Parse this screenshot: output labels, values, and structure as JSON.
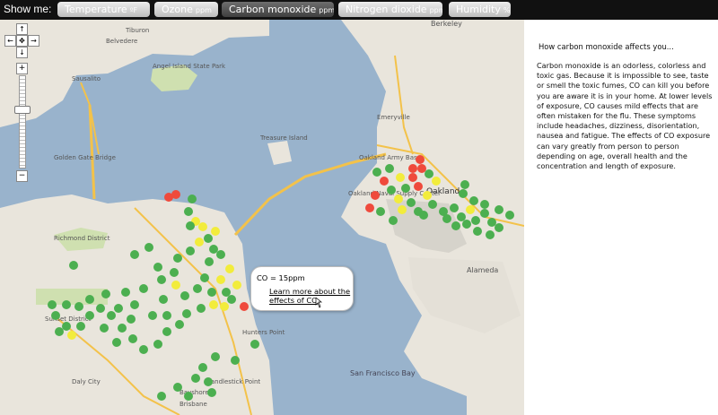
{
  "header": {
    "show_me_label": "Show me:",
    "tabs": [
      {
        "label": "Temperature",
        "unit": "ºF"
      },
      {
        "label": "Ozone",
        "unit": "ppm"
      },
      {
        "label": "Carbon monoxide",
        "unit": "ppm"
      },
      {
        "label": "Nitrogen dioxide",
        "unit": "ppm"
      },
      {
        "label": "Humidity",
        "unit": "%"
      }
    ]
  },
  "map": {
    "labels": [
      "Berkeley",
      "Emeryville",
      "Oakland",
      "Alameda",
      "San Francisco Bay",
      "Treasure Island",
      "Angel Island State Park",
      "Tiburon",
      "Belvedere",
      "Sausalito",
      "Golden Gate Bridge",
      "Richmond District",
      "Sunset District",
      "Daly City",
      "Hunters Point",
      "Candlestick Point",
      "Bayshore",
      "Brisbane",
      "Oakland Army Base",
      "Oakland Naval Supply Center"
    ],
    "popup": {
      "value": "CO = 15ppm",
      "link": "Learn more about the effects of CO"
    }
  },
  "sidebar": {
    "title": "How carbon monoxide affects you...",
    "body": "Carbon monoxide is an odorless, colorless and toxic gas. Because it is impossible to see, taste or smell the toxic fumes, CO can kill you before you are aware it is in your home. At lower levels of exposure, CO causes mild effects that are often mistaken for the flu. These symptoms include headaches, dizziness, disorientation, nausea and fatigue. The effects of CO exposure can vary greatly from person to person depending on age, overall health and the concentration and length of exposure."
  },
  "colors": {
    "low": "#4caf50",
    "moderate": "#f2ec3c",
    "high": "#ef4a3c"
  }
}
